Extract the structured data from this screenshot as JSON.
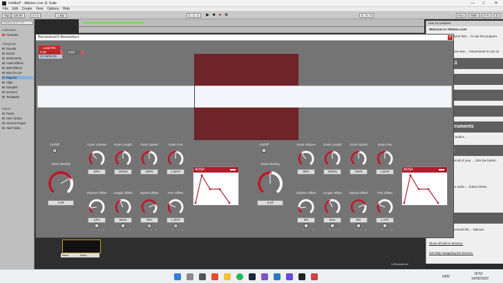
{
  "window": {
    "title": "Untitled* - Ableton Live 11 Suite",
    "minimize": "—",
    "maximize": "□",
    "close": "✕"
  },
  "menu": [
    "File",
    "Edit",
    "Create",
    "View",
    "Options",
    "Help"
  ],
  "transport": {
    "tap": "Tap",
    "tempo": "120.00",
    "meter": "4 / 4",
    "quant": "1 Bar",
    "pos": "1 . 1 . 1",
    "end": "4 . 0 . 0",
    "key": "Key",
    "midi": "MIDI",
    "cpu": "0 %",
    "dim": "D"
  },
  "browser": {
    "search_placeholder": "Search (Ctrl + F)",
    "collections_header": "Collections",
    "favorites": "Favorites",
    "categories_header": "Categories",
    "categories": [
      "Sounds",
      "Drums",
      "Instruments",
      "Audio Effects",
      "MIDI Effects",
      "Max for Live",
      "Plug-Ins",
      "Clips",
      "Samples",
      "Grooves",
      "Templates"
    ],
    "places_header": "Places",
    "places": [
      "Packs",
      "User Library",
      "Current Project",
      "Add Folder..."
    ]
  },
  "lessons": {
    "header": "Live 11 Lessons",
    "welcome": "Welcome to Ableton Live!",
    "intro": "... collection of lessons that ... to use the program.",
    "new_intro": "Live 11 - Learn about new ... movements in Live 11",
    "bands": [
      "w in Live 11",
      "ive",
      "Audio",
      "eats",
      "ftware Instruments",
      "re Devices",
      "rollers"
    ],
    "t1": "... Learn about the built-in ...",
    "t2": "... information about all of your ... click the button below.",
    "t3": "... lp setting up your audio ... button below.",
    "t4": "... arn about Live, consult the ... Manual.",
    "show_all": "Show all built-in lessons.",
    "help": "Get help navigating the lessons."
  },
  "plugin": {
    "title": "Reconstruct/1-Reconstruct",
    "close": "✕",
    "load_file": "Load File",
    "pos_a": "0.38",
    "pos_b": "0.63",
    "time": "02:18/06:09",
    "colors": {
      "red": "#b01d2c",
      "panel": "#747474",
      "block": "#6e2429"
    },
    "sides": [
      {
        "onoff": "On/Off",
        "onoff_checked": true,
        "density_label": "Grain Density",
        "density": "1.00",
        "volume_label": "Grain Volume",
        "volume": "34%",
        "length_label": "Grain Length",
        "length": "102ms",
        "speed_label": "Grain Speed",
        "speed": "100%",
        "pan_label": "Grain Pan",
        "pan": "L  50  R",
        "voff_label": "Volume Offset",
        "voff": "14%",
        "loff_label": "Length Offset",
        "loff": "84ms",
        "soff_label": "Speed Offset",
        "soff": "75%",
        "poff_label": "Pan Offset",
        "poff": "L 25 R",
        "adsr": "ADSR"
      },
      {
        "onoff": "On/Off",
        "onoff_checked": false,
        "density_label": "Grain Density",
        "density": "0.10",
        "volume_label": "Grain Volume",
        "volume": "50%",
        "length_label": "Grain Length",
        "length": "100ms",
        "speed_label": "Grain Speed",
        "speed": "100%",
        "pan_label": "Grain Pan",
        "pan": "L  50  R",
        "voff_label": "Volume Offset",
        "voff": "0%",
        "loff_label": "Length Offset",
        "loff": "0ms",
        "soff_label": "Speed Offset",
        "soff": "0%",
        "poff_label": "Pan Offset",
        "poff": "L 0 R",
        "adsr": "ADSR"
      }
    ],
    "mini": [
      "-",
      "+",
      "÷",
      "×"
    ]
  },
  "bottom": {
    "none1": "None",
    "none2": "None",
    "track": "1-Reconstruct"
  },
  "taskbar": {
    "lang": "DAN",
    "time": "18:52",
    "date": "14/05/2023"
  }
}
